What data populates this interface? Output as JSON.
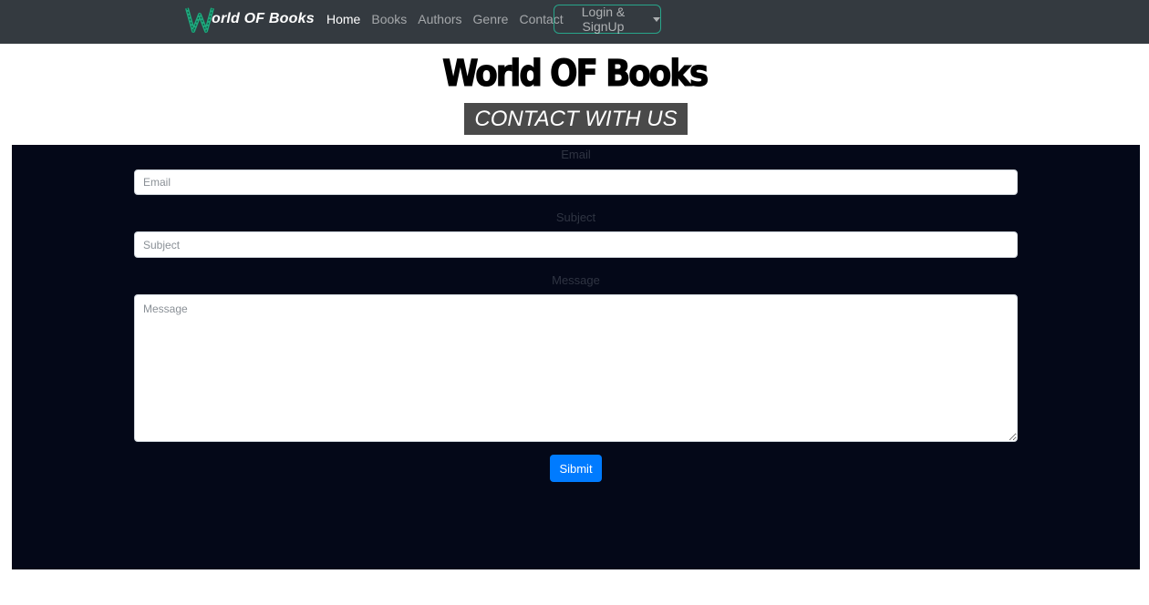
{
  "navbar": {
    "brand_text": "orld OF Books",
    "brand_icon": "w-letter-logo",
    "links": [
      {
        "label": "Home",
        "active": true
      },
      {
        "label": "Books",
        "active": false
      },
      {
        "label": "Authors",
        "active": false
      },
      {
        "label": "Genre",
        "active": false
      },
      {
        "label": "Contact",
        "active": false
      }
    ],
    "dropdown_label": "Login & SignUp"
  },
  "header": {
    "title": "World OF Books",
    "banner": "CONTACT WITH US"
  },
  "form": {
    "email": {
      "label": "Email",
      "placeholder": "Email",
      "value": ""
    },
    "subject": {
      "label": "Subject",
      "placeholder": "Subject",
      "value": ""
    },
    "message": {
      "label": "Message",
      "placeholder": "Message",
      "value": ""
    },
    "submit_label": "Sibmit"
  },
  "colors": {
    "navbar_bg": "#343a40",
    "form_bg": "#040818",
    "accent": "#28a58a",
    "button": "#007bff",
    "banner_bg": "#4a4a4a"
  }
}
